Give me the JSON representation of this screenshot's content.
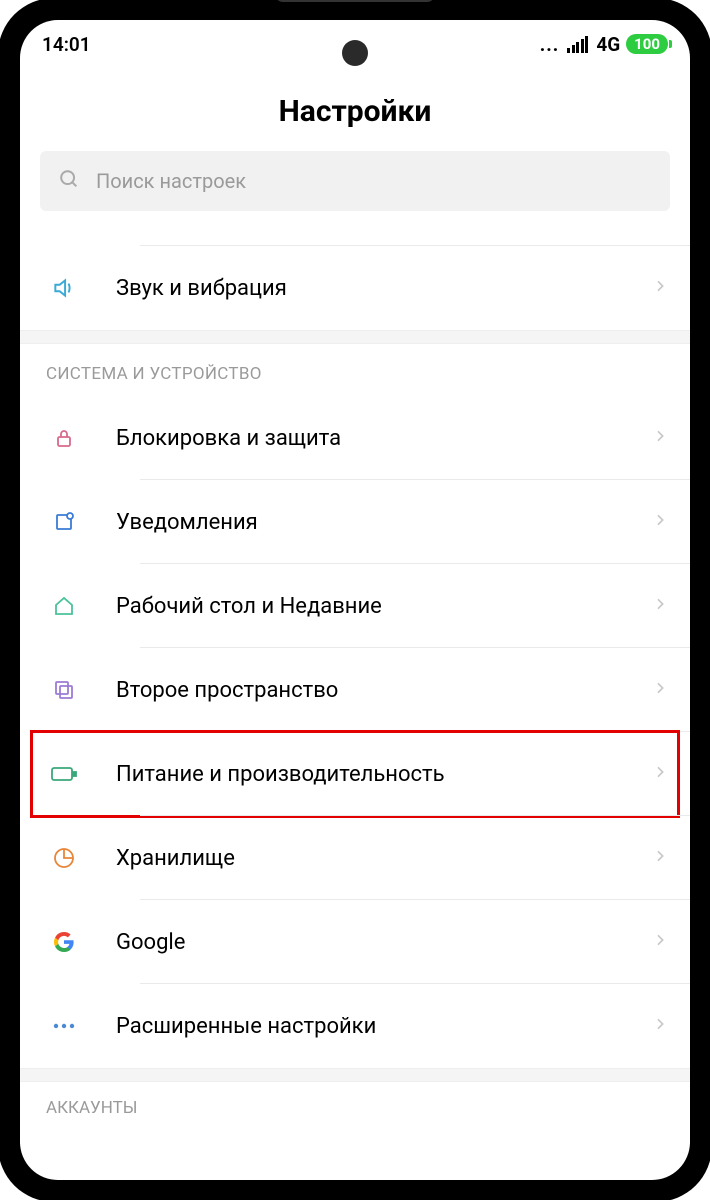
{
  "status": {
    "time": "14:01",
    "network": "4G",
    "battery": "100"
  },
  "title": "Настройки",
  "search": {
    "placeholder": "Поиск настроек"
  },
  "top_rows": [
    {
      "label": "Звук и вибрация"
    }
  ],
  "section1_header": "СИСТЕМА И УСТРОЙСТВО",
  "section1_rows": [
    {
      "label": "Блокировка и защита"
    },
    {
      "label": "Уведомления"
    },
    {
      "label": "Рабочий стол и Недавние"
    },
    {
      "label": "Второе пространство"
    },
    {
      "label": "Питание и производительность"
    },
    {
      "label": "Хранилище"
    },
    {
      "label": "Google"
    },
    {
      "label": "Расширенные настройки"
    }
  ],
  "section2_header": "АККАУНТЫ"
}
